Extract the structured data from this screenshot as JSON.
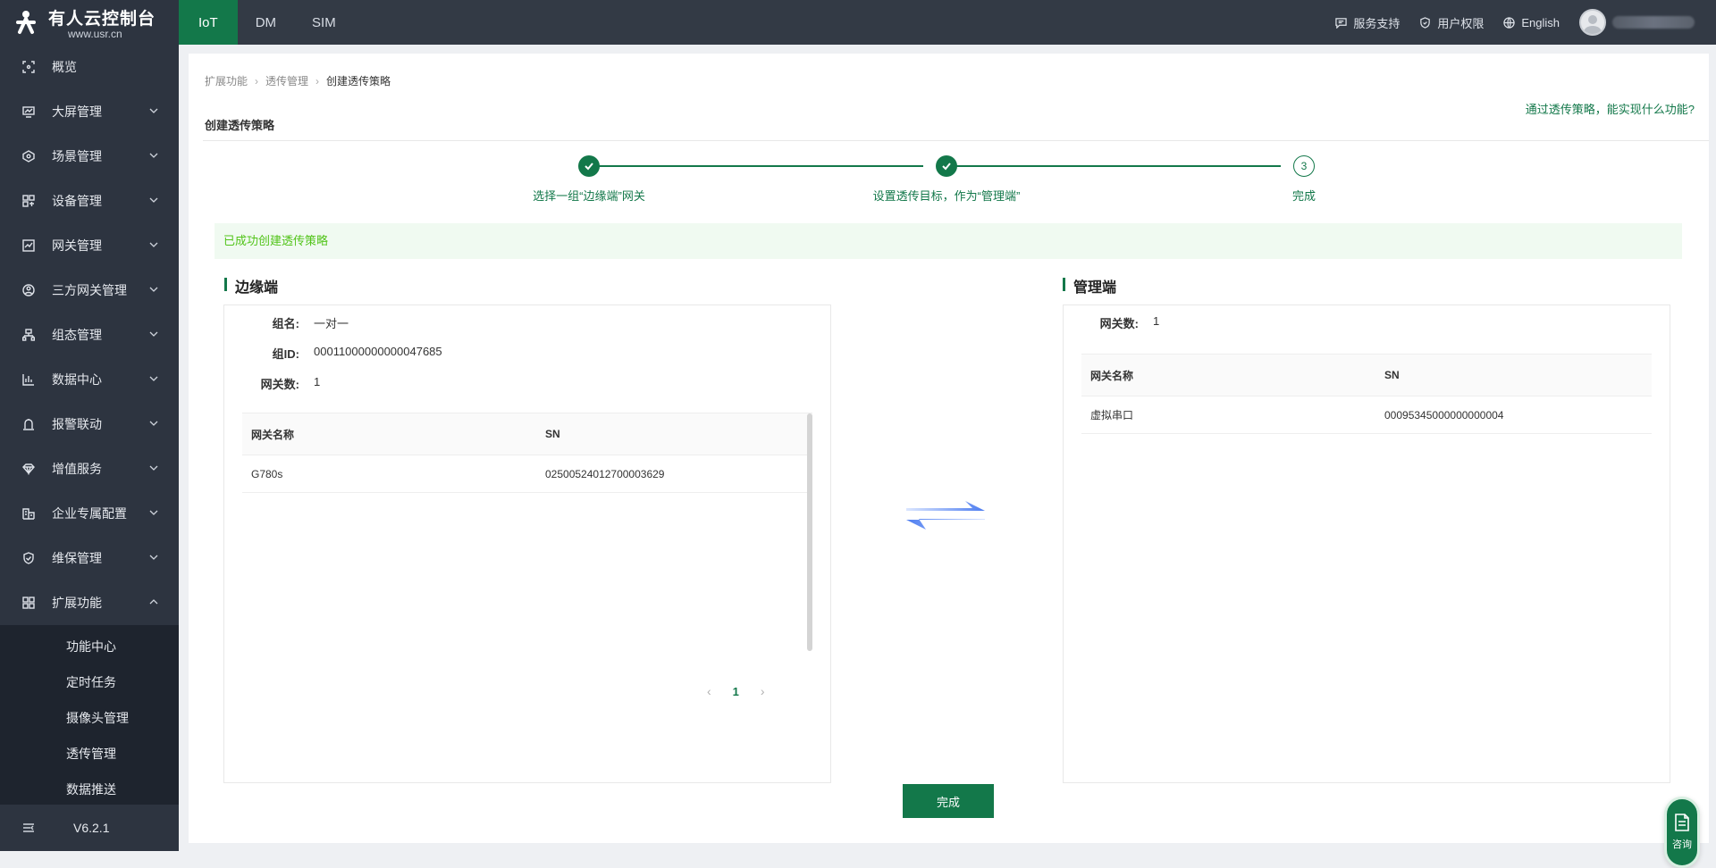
{
  "app": {
    "logo_title": "有人云控制台",
    "logo_url": "www.usr.cn",
    "version": "V6.2.1"
  },
  "sidebar": {
    "items": [
      {
        "label": "概览",
        "icon": "overview-icon"
      },
      {
        "label": "大屏管理",
        "icon": "screen-icon"
      },
      {
        "label": "场景管理",
        "icon": "scene-icon"
      },
      {
        "label": "设备管理",
        "icon": "device-icon"
      },
      {
        "label": "网关管理",
        "icon": "gateway-icon"
      },
      {
        "label": "三方网关管理",
        "icon": "third-party-gateway-icon"
      },
      {
        "label": "组态管理",
        "icon": "configuration-icon"
      },
      {
        "label": "数据中心",
        "icon": "data-center-icon"
      },
      {
        "label": "报警联动",
        "icon": "alarm-icon"
      },
      {
        "label": "增值服务",
        "icon": "value-added-icon"
      },
      {
        "label": "企业专属配置",
        "icon": "enterprise-icon"
      },
      {
        "label": "维保管理",
        "icon": "maintenance-icon"
      },
      {
        "label": "扩展功能",
        "icon": "extension-icon"
      }
    ],
    "submenu": [
      "功能中心",
      "定时任务",
      "摄像头管理",
      "透传管理",
      "数据推送"
    ]
  },
  "topbar": {
    "tabs": [
      "IoT",
      "DM",
      "SIM"
    ],
    "active_tab": "IoT",
    "links": {
      "support": "服务支持",
      "permissions": "用户权限",
      "language": "English"
    }
  },
  "page": {
    "breadcrumb": [
      "扩展功能",
      "透传管理",
      "创建透传策略"
    ],
    "title": "创建透传策略",
    "help_link": "通过透传策略，能实现什么功能?",
    "steps": [
      {
        "label": "选择一组“边缘端”网关",
        "status": "done"
      },
      {
        "label": "设置透传目标，作为“管理端”",
        "status": "done"
      },
      {
        "label": "完成",
        "status": "current",
        "number": "3"
      }
    ],
    "success_message": "已成功创建透传策略",
    "edge": {
      "title": "边缘端",
      "fields": [
        {
          "key": "组名:",
          "value": "一对一"
        },
        {
          "key": "组ID:",
          "value": "00011000000000047685"
        },
        {
          "key": "网关数:",
          "value": "1"
        }
      ],
      "table": {
        "columns": [
          "网关名称",
          "SN"
        ],
        "rows": [
          [
            "G780s",
            "02500524012700003629"
          ]
        ]
      },
      "pagination": {
        "current": "1"
      }
    },
    "manage": {
      "title": "管理端",
      "fields": [
        {
          "key": "网关数:",
          "value": "1"
        }
      ],
      "table": {
        "columns": [
          "网关名称",
          "SN"
        ],
        "rows": [
          [
            "虚拟串口",
            "00095345000000000004"
          ]
        ]
      }
    },
    "finish_button": "完成",
    "consult_label": "咨询"
  },
  "colors": {
    "primary": "#13784a",
    "sidebar_bg": "#2d3440",
    "topbar_bg": "#333a45",
    "success_text": "#52c41a",
    "success_bg": "#f0faf1"
  }
}
